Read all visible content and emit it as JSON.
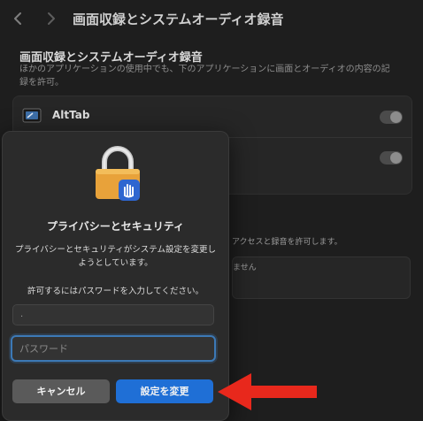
{
  "toolbar": {
    "back_icon": "chevron-left-icon",
    "forward_icon": "chevron-right-icon",
    "title": "画面収録とシステムオーディオ録音"
  },
  "section": {
    "title": "画面収録とシステムオーディオ録音",
    "description": "ほかのアプリケーションの使用中でも、下のアプリケーションに画面とオーディオの内容の記録を許可。"
  },
  "apps": [
    {
      "name": "AltTab",
      "enabled": true
    },
    {
      "name": "",
      "enabled": true
    }
  ],
  "second_section": {
    "description": "アクセスと録音を許可します。",
    "list_empty": "ません"
  },
  "dialog": {
    "icon": "lock-with-hand-icon",
    "title": "プライバシーとセキュリティ",
    "message": "プライバシーとセキュリティがシステム設定を変更しようとしています。",
    "prompt": "許可するにはパスワードを入力してください。",
    "username_value": ".",
    "password_placeholder": "パスワード",
    "cancel_label": "キャンセル",
    "confirm_label": "設定を変更"
  },
  "colors": {
    "accent": "#1f6fd6",
    "annotation_arrow": "#e8281c",
    "background": "#1e1e1e"
  }
}
